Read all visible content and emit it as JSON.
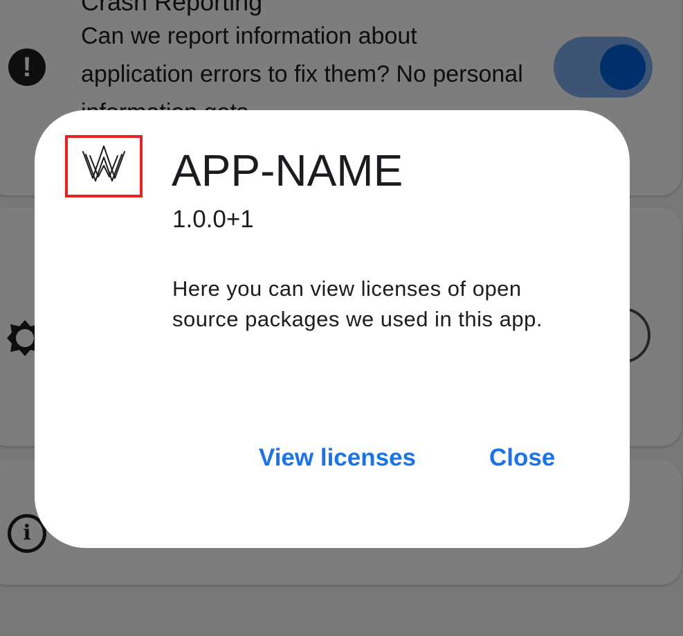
{
  "settings": {
    "crash_reporting": {
      "title": "Crash Reporting",
      "description": "Can we report information about application errors to fix them? No personal information gets",
      "icon": "error-icon",
      "toggle_enabled": true
    },
    "theme": {
      "icon": "brightness-icon"
    },
    "about": {
      "icon": "info-icon",
      "icon_glyph": "i"
    }
  },
  "about_dialog": {
    "logo_icon": "app-logo-icon",
    "app_name": "APP-NAME",
    "version": "1.0.0+1",
    "legalese": "Here you can view licenses of open source packages we used in this app.",
    "view_licenses_label": "View licenses",
    "close_label": "Close"
  },
  "colors": {
    "accent": "#1a73e8",
    "toggle_track": "#7aa8e8",
    "toggle_knob": "#0061d6",
    "logo_highlight_border": "#e52121",
    "scrim": "rgba(0,0,0,0.5)"
  }
}
